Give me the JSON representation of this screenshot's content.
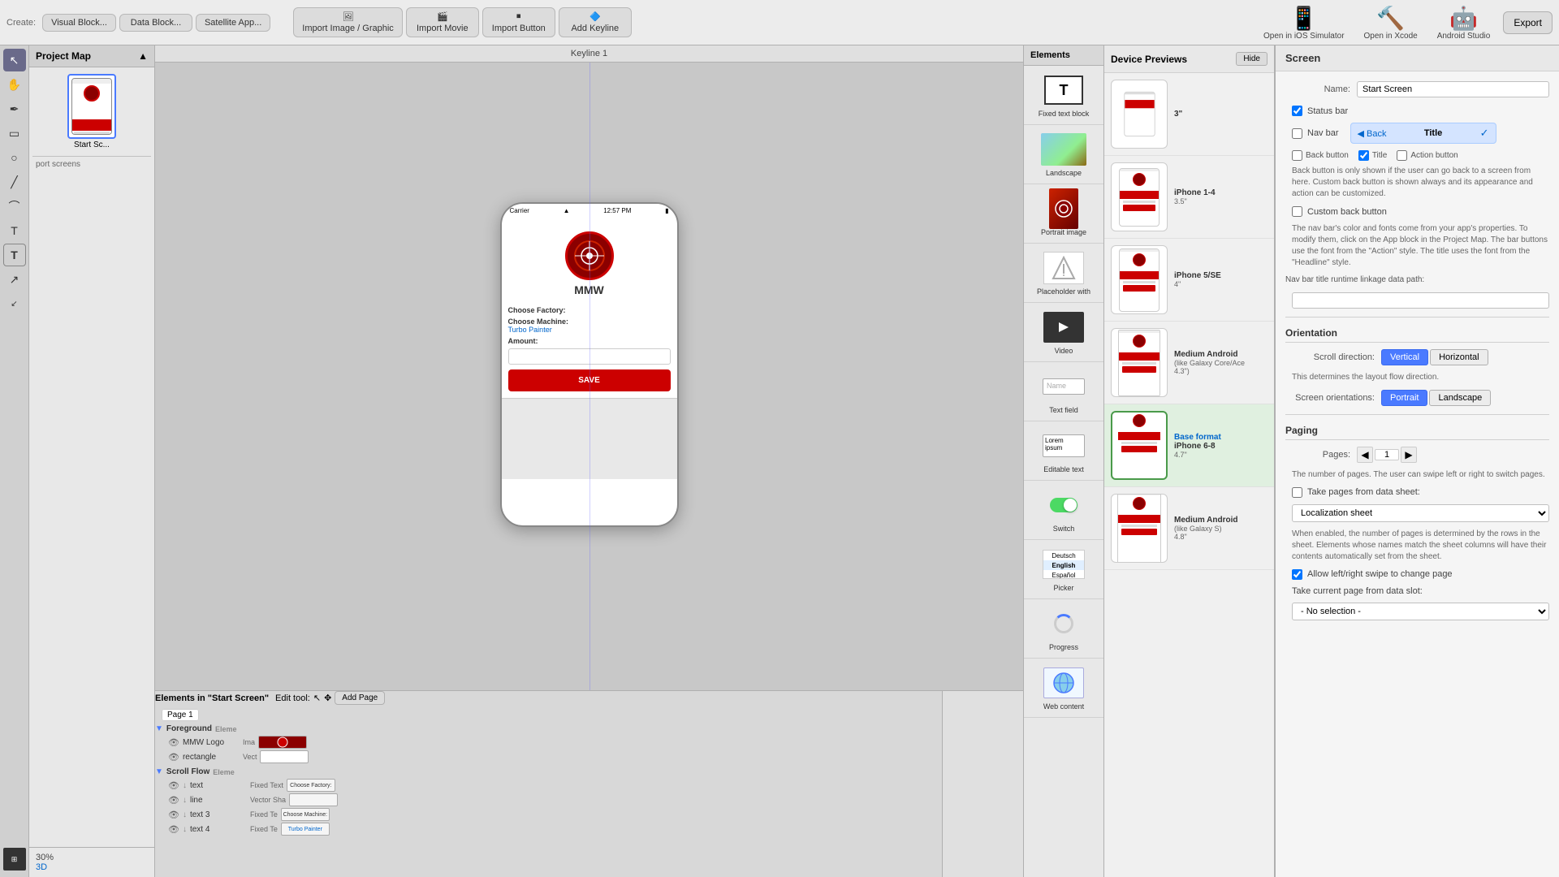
{
  "toolbar": {
    "create_label": "Create:",
    "visual_block_btn": "Visual Block...",
    "data_block_btn": "Data Block...",
    "satellite_app_btn": "Satellite App...",
    "import_graphic_btn": "Import Image / Graphic",
    "import_movie_btn": "Import Movie",
    "import_button_btn": "Import Button",
    "add_keyline_btn": "Add Keyline",
    "open_ios_btn": "Open in iOS Simulator",
    "open_xcode_btn": "Open in Xcode",
    "android_studio_btn": "Android Studio",
    "export_btn": "Export"
  },
  "project_map": {
    "title": "Project Map",
    "screen_label": "Start Sc...",
    "port_screens": "port screens",
    "percent": "30%",
    "three_d": "3D"
  },
  "keyline": {
    "label": "Keyline 1"
  },
  "phone": {
    "carrier": "Carrier",
    "time": "12:57 PM",
    "brand": "MMW",
    "choose_factory": "Choose Factory:",
    "choose_machine": "Choose Machine:",
    "machine_value": "Turbo Painter",
    "amount_label": "Amount:",
    "save_btn": "SAVE"
  },
  "elements_panel": {
    "header": "Elements",
    "hide_btn": "Hide",
    "items": [
      {
        "label": "Fixed text block",
        "icon": "T"
      },
      {
        "label": "Landscape",
        "icon": "landscape"
      },
      {
        "label": "Portrait image",
        "icon": "portrait"
      },
      {
        "label": "Placeholder with",
        "icon": "placeholder"
      },
      {
        "label": "Video",
        "icon": "video"
      },
      {
        "label": "Text field",
        "icon": "textfield"
      },
      {
        "label": "Editable text",
        "icon": "editable"
      },
      {
        "label": "Switch",
        "icon": "switch"
      },
      {
        "label": "Picker",
        "icon": "picker"
      },
      {
        "label": "Progress",
        "icon": "progress"
      },
      {
        "label": "Web content",
        "icon": "web"
      }
    ]
  },
  "device_previews": {
    "title": "Device Previews",
    "hide_btn": "Hide",
    "devices": [
      {
        "name": "3\"",
        "size": ""
      },
      {
        "name": "iPhone 1-4",
        "size": "3.5\""
      },
      {
        "name": "iPhone 5/SE",
        "size": "4\""
      },
      {
        "name": "Medium Android",
        "size": "(like Galaxy Core/Ace\n4.3\")"
      },
      {
        "name": "Base format",
        "size": "iPhone 6-8\n4.7\"",
        "is_base": true
      },
      {
        "name": "Medium Android",
        "size": "(like Galaxy S)\n4.8\""
      }
    ]
  },
  "bottom_panel": {
    "elements_in": "Elements in \"Start Screen\"",
    "edit_tool_label": "Edit tool:",
    "add_page_btn": "Add Page",
    "page_label": "Page 1",
    "groups": [
      {
        "name": "Foreground",
        "type": "Eleme",
        "items": [
          {
            "name": "MMW Logo",
            "type": "Ima",
            "preview": "logo",
            "has_eye": true
          },
          {
            "name": "rectangle",
            "type": "Vect",
            "preview": "white",
            "has_eye": true
          }
        ]
      },
      {
        "name": "Scroll Flow",
        "type": "Eleme",
        "items": [
          {
            "name": "text",
            "type": "Fixed Text",
            "preview": "Choose Factory:",
            "has_eye": true,
            "arrow": true
          },
          {
            "name": "line",
            "type": "Vector Sha",
            "preview": "",
            "has_eye": true,
            "arrow": true
          },
          {
            "name": "text 3",
            "type": "Fixed Te",
            "preview": "Choose Machine:",
            "has_eye": true,
            "arrow": true
          },
          {
            "name": "text 4",
            "type": "Fixed Te",
            "preview": "Turbo Painter",
            "has_eye": true,
            "arrow": true
          }
        ]
      }
    ]
  },
  "right_props": {
    "section_title": "Screen",
    "name_label": "Name:",
    "name_value": "Start Screen",
    "status_bar_label": "Status bar",
    "nav_bar_label": "Nav bar",
    "nav_bar_back": "Back",
    "nav_bar_title": "Title",
    "back_button_label": "Back button",
    "title_label": "Title",
    "action_button_label": "Action button",
    "nav_bar_desc": "Back button is only shown if the user can go back to a screen from here. Custom back button is shown always and its appearance and action can be customized.",
    "custom_back_label": "Custom back button",
    "nav_title_desc": "The nav bar's color and fonts come from your app's properties. To modify them, click on the App block in the Project Map. The bar buttons use the font from the \"Action\" style. The title uses the font from the \"Headline\" style.",
    "nav_runtime_label": "Nav bar title runtime linkage data path:",
    "orientation_label": "Orientation",
    "scroll_dir_label": "Scroll direction:",
    "scroll_vertical": "Vertical",
    "scroll_horizontal": "Horizontal",
    "scroll_dir_desc": "This determines the layout flow direction.",
    "screen_orient_label": "Screen orientations:",
    "portrait_btn": "Portrait",
    "landscape_btn": "Landscape",
    "paging_title": "Paging",
    "pages_label": "Pages:",
    "pages_value": "1",
    "pages_desc": "The number of pages. The user can swipe left or right to switch pages.",
    "take_pages_label": "Take pages from data sheet:",
    "localization_sheet": "Localization sheet",
    "sheet_desc": "When enabled, the number of pages is determined by the rows in the sheet. Elements whose names match the sheet columns will have their contents automatically set from the sheet.",
    "allow_swipe_label": "Allow left/right swipe to change page",
    "take_current_label": "Take current page from data slot:",
    "no_selection": "- No selection -"
  }
}
